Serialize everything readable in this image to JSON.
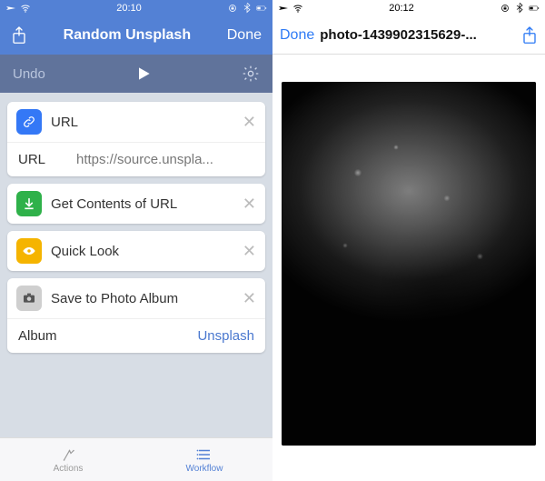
{
  "left": {
    "status": {
      "time": "20:10"
    },
    "nav": {
      "title": "Random Unsplash",
      "done": "Done"
    },
    "toolbar": {
      "undo": "Undo"
    },
    "cards": [
      {
        "icon": "link-icon",
        "title": "URL",
        "field_label": "URL",
        "field_value": "https://source.unspla..."
      },
      {
        "icon": "download-icon",
        "title": "Get Contents of URL"
      },
      {
        "icon": "eye-icon",
        "title": "Quick Look"
      },
      {
        "icon": "camera-icon",
        "title": "Save to Photo Album",
        "field_label": "Album",
        "field_value": "Unsplash"
      }
    ],
    "tabs": {
      "actions": "Actions",
      "workflow": "Workflow"
    }
  },
  "right": {
    "status": {
      "time": "20:12"
    },
    "nav": {
      "done": "Done",
      "title": "photo-1439902315629-..."
    }
  },
  "colors": {
    "brand": "#5381d5",
    "toolbar": "#60739b",
    "link": "#2f7bf5"
  }
}
